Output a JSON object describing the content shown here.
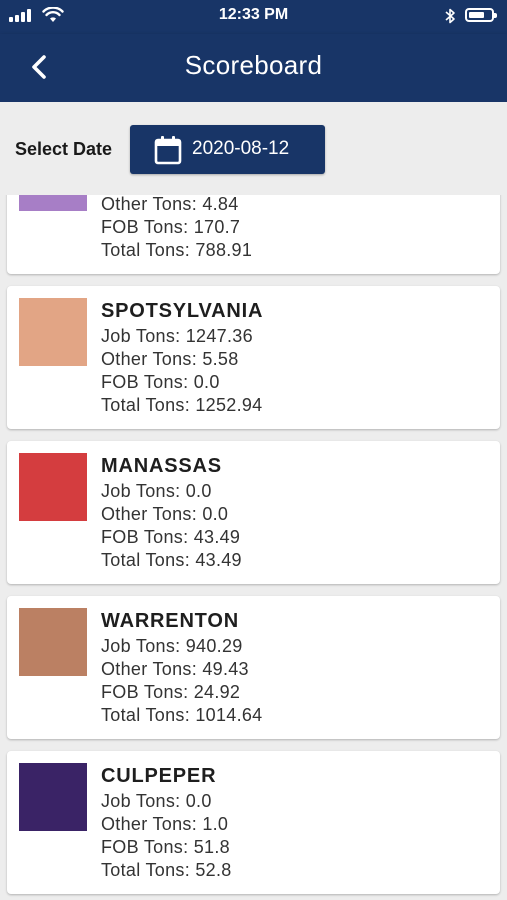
{
  "status_bar": {
    "time": "12:33 PM"
  },
  "header": {
    "title": "Scoreboard"
  },
  "date_picker": {
    "label": "Select Date",
    "value": "2020-08-12"
  },
  "cards": [
    {
      "name": "",
      "color": "#a77ec6",
      "other_tons": "Other Tons: 4.84",
      "fob_tons": "FOB Tons: 170.7",
      "total_tons": "Total Tons: 788.91"
    },
    {
      "name": "SPOTSYLVANIA",
      "color": "#e2a585",
      "job_tons": "Job Tons: 1247.36",
      "other_tons": "Other Tons: 5.58",
      "fob_tons": "FOB Tons: 0.0",
      "total_tons": "Total Tons: 1252.94"
    },
    {
      "name": "MANASSAS",
      "color": "#d43d3f",
      "job_tons": "Job Tons: 0.0",
      "other_tons": "Other Tons: 0.0",
      "fob_tons": "FOB Tons: 43.49",
      "total_tons": "Total Tons: 43.49"
    },
    {
      "name": "WARRENTON",
      "color": "#bb8063",
      "job_tons": "Job Tons: 940.29",
      "other_tons": "Other Tons: 49.43",
      "fob_tons": "FOB Tons: 24.92",
      "total_tons": "Total Tons: 1014.64"
    },
    {
      "name": "CULPEPER",
      "color": "#3a2366",
      "job_tons": "Job Tons: 0.0",
      "other_tons": "Other Tons: 1.0",
      "fob_tons": "FOB Tons: 51.8",
      "total_tons": "Total Tons: 52.8"
    }
  ]
}
